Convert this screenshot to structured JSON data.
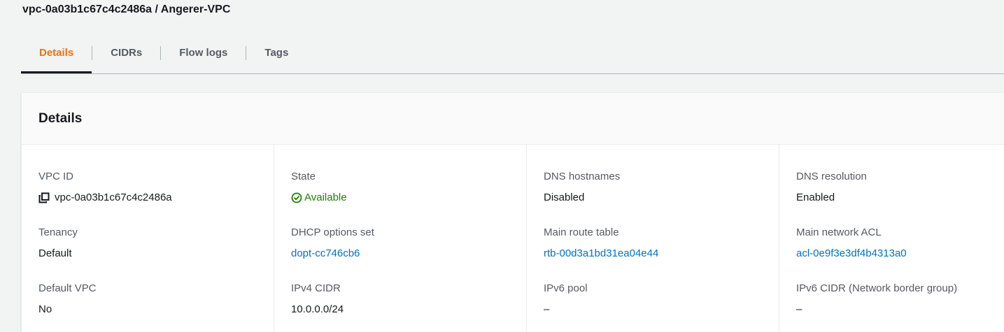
{
  "header": {
    "title": "vpc-0a03b1c67c4c2486a / Angerer-VPC"
  },
  "tabs": [
    {
      "label": "Details",
      "active": true
    },
    {
      "label": "CIDRs",
      "active": false
    },
    {
      "label": "Flow logs",
      "active": false
    },
    {
      "label": "Tags",
      "active": false
    }
  ],
  "panel": {
    "title": "Details",
    "columns": [
      [
        {
          "label": "VPC ID",
          "value": "vpc-0a03b1c67c4c2486a",
          "icon": "copy-icon"
        },
        {
          "label": "Tenancy",
          "value": "Default"
        },
        {
          "label": "Default VPC",
          "value": "No"
        }
      ],
      [
        {
          "label": "State",
          "value": "Available",
          "icon": "check-circle-icon"
        },
        {
          "label": "DHCP options set",
          "value": "dopt-cc746cb6"
        },
        {
          "label": "IPv4 CIDR",
          "value": "10.0.0.0/24"
        }
      ],
      [
        {
          "label": "DNS hostnames",
          "value": "Disabled"
        },
        {
          "label": "Main route table",
          "value": "rtb-00d3a1bd31ea04e44"
        },
        {
          "label": "IPv6 pool",
          "value": "–"
        }
      ],
      [
        {
          "label": "DNS resolution",
          "value": "Enabled"
        },
        {
          "label": "Main network ACL",
          "value": "acl-0e9f3e3df4b4313a0"
        },
        {
          "label": "IPv6 CIDR (Network border group)",
          "value": "–"
        }
      ]
    ]
  },
  "colors": {
    "accent": "#ec7211",
    "link": "#0073bb",
    "success": "#1d8102",
    "label": "#545b64",
    "text": "#16191f"
  }
}
